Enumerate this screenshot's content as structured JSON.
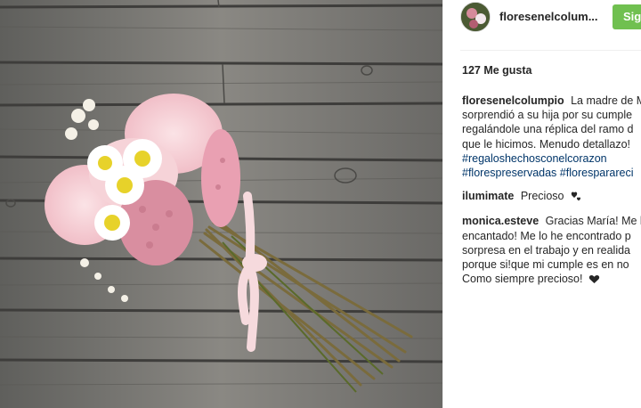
{
  "post": {
    "image_alt": "Flower bouquet on wooden planks",
    "author": "floresenelcolum...",
    "follow_label": "Sig",
    "likes": "127 Me gusta"
  },
  "comments": [
    {
      "user": "floresenelcolumpio",
      "lines": [
        "La madre de M",
        "sorprendió a su hija por su cumple",
        "regalándole una réplica del ramo d",
        "que le hicimos. Menudo detallazo!"
      ],
      "tags": [
        "#regaloshechosconelcorazon",
        "#florespreservadas",
        "#floresparareci"
      ]
    },
    {
      "user": "ilumimate",
      "lines": [
        "Precioso"
      ],
      "emoji": "hearts-icon"
    },
    {
      "user": "monica.esteve",
      "lines": [
        "Gracias María! Me h",
        "encantado! Me lo he encontrado p",
        "sorpresa en el trabajo y en realida",
        "porque si!que mi cumple es en no",
        "Como siempre precioso!"
      ],
      "emoji": "heart-icon"
    }
  ]
}
